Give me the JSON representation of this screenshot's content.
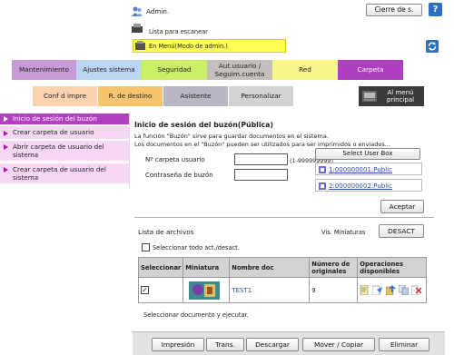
{
  "header": {
    "username": "Admin.",
    "logout_label": "Cierre de s.",
    "help_label": "?",
    "scanner_status": "Lista para escanear",
    "mode_text": "En Menú(Modo de admin.)"
  },
  "tabs_row1": [
    {
      "label": "Mantenimiento",
      "color": "#c99bd6"
    },
    {
      "label": "Ajustes sistema",
      "color": "#bcd5f2"
    },
    {
      "label": "Seguridad",
      "color": "#ccee66"
    },
    {
      "label": "Aut.usuario / Seguim.cuenta",
      "color": "#c4bfbc"
    },
    {
      "label": "Red",
      "color": "#f7f78a"
    },
    {
      "label": "Carpeta",
      "color": "#b03fc0"
    }
  ],
  "tabs_row2": [
    {
      "label": "Conf d impre",
      "color": "#fcd3b0"
    },
    {
      "label": "R. de destino",
      "color": "#f7c46e"
    },
    {
      "label": "Asistente",
      "color": "#b9b6c3"
    },
    {
      "label": "Personalizar",
      "color": "#d4d2d0"
    }
  ],
  "main_menu_label": "Al menú principal",
  "sidebar": {
    "items": [
      {
        "label": "Inicio de sesión del buzón",
        "active": true
      },
      {
        "label": "Crear carpeta de usuario",
        "active": false
      },
      {
        "label": "Abrir carpeta de usuario del sistema",
        "active": false
      },
      {
        "label": "Crear carpeta de usuario del sistema",
        "active": false
      }
    ]
  },
  "login": {
    "title": "Inicio de sesión del buzón(Pública)",
    "desc_line1": "La función \"Buzón\" sirve para guardar documentos en el sistema.",
    "desc_line2": "Los documentos en el \"Buzón\" pueden ser utilizados para ser imprimidos o enviados...",
    "folder_label": "Nº carpeta usuario",
    "folder_value": "",
    "folder_range": "(1-999999999)",
    "password_label": "Contraseña de buzón",
    "password_value": "",
    "select_box_label": "Select User Box",
    "boxes": [
      "1:000000001:Public",
      "2:000000002:Public"
    ],
    "accept_label": "Aceptar"
  },
  "files": {
    "title": "Lista de archivos",
    "thumb_view_label": "Vis. Miniaturas",
    "thumb_toggle": "DESACT",
    "select_all_label": "Seleccionar todo act./desact.",
    "columns": [
      "Seleccionar",
      "Miniatura",
      "Nombre doc",
      "Número de originales",
      "Operaciones disponibles"
    ],
    "rows": [
      {
        "checked": true,
        "name": "TEST1",
        "originals": "9"
      }
    ],
    "hint": "Seleccionar documento y ejecutar."
  },
  "actions": [
    "Impresión",
    "Trans.",
    "Descargar",
    "Mover / Copiar",
    "Eliminar"
  ]
}
